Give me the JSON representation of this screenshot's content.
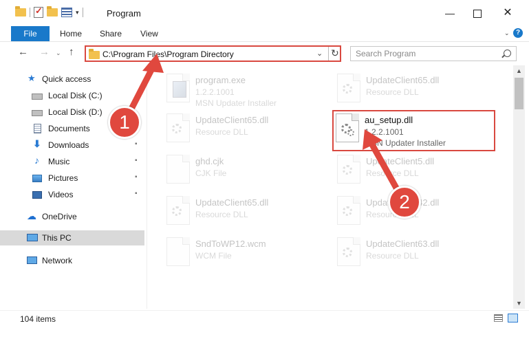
{
  "window": {
    "title": "Program",
    "controls": {
      "minimize": "—",
      "maximize": "",
      "close": "✕"
    }
  },
  "ribbon": {
    "file": "File",
    "tabs": [
      "Home",
      "Share",
      "View"
    ],
    "collapse": "⌄",
    "help": "?"
  },
  "nav": {
    "back": "←",
    "forward": "→",
    "recent": "⌄",
    "up": "↑",
    "address": "C:\\Program Files\\Program Directory",
    "address_dropdown": "⌄",
    "refresh": "↻",
    "search_placeholder": "Search Program"
  },
  "sidebar": {
    "items": [
      {
        "label": "Quick access",
        "icon": "star-icon"
      },
      {
        "label": "Local Disk (C:)",
        "icon": "disk-icon",
        "pinned": true
      },
      {
        "label": "Local Disk (D:)",
        "icon": "disk-icon",
        "pinned": true
      },
      {
        "label": "Documents",
        "icon": "documents-icon",
        "pinned": true
      },
      {
        "label": "Downloads",
        "icon": "downloads-icon",
        "pinned": true
      },
      {
        "label": "Music",
        "icon": "music-icon",
        "pinned": true
      },
      {
        "label": "Pictures",
        "icon": "pictures-icon",
        "pinned": true
      },
      {
        "label": "Videos",
        "icon": "videos-icon",
        "pinned": true
      },
      {
        "label": "OneDrive",
        "icon": "onedrive-icon"
      },
      {
        "label": "This PC",
        "icon": "this-pc-icon",
        "selected": true
      },
      {
        "label": "Network",
        "icon": "network-icon"
      }
    ],
    "pin_glyph": "📌"
  },
  "files": [
    {
      "name": "program.exe",
      "version": "1.2.2.1001",
      "description": "MSN Updater Installer",
      "icon": "exe-icon"
    },
    {
      "name": "UpdateClient65.dll",
      "version": "",
      "description": "Resource DLL",
      "icon": "dll-icon"
    },
    {
      "name": "UpdateClient65.dll",
      "version": "",
      "description": "Resource DLL",
      "icon": "dll-icon"
    },
    {
      "name": "au_setup.dll",
      "version": "1.2.2.1001",
      "description": "MSN Updater Installer",
      "icon": "dll-gear-icon",
      "highlighted": true
    },
    {
      "name": "ghd.cjk",
      "version": "",
      "description": "CJK File",
      "icon": "file-icon"
    },
    {
      "name": "UpdateClient5.dll",
      "version": "",
      "description": "Resource DLL",
      "icon": "dll-icon"
    },
    {
      "name": "UpdateClient65.dll",
      "version": "",
      "description": "Resource DLL",
      "icon": "dll-icon"
    },
    {
      "name": "UpdateClient42.dll",
      "version": "",
      "description": "Resource DLL",
      "icon": "dll-icon"
    },
    {
      "name": "SndToWP12.wcm",
      "version": "",
      "description": "WCM File",
      "icon": "file-icon"
    },
    {
      "name": "UpdateClient63.dll",
      "version": "",
      "description": "Resource DLL",
      "icon": "dll-icon"
    }
  ],
  "status": {
    "item_count": "104 items"
  },
  "annotations": {
    "step1": "1",
    "step2": "2",
    "color": "#e0483e"
  },
  "colors": {
    "accent": "#1979ca",
    "highlight": "#d9483f",
    "selection": "#d9d9d9"
  }
}
